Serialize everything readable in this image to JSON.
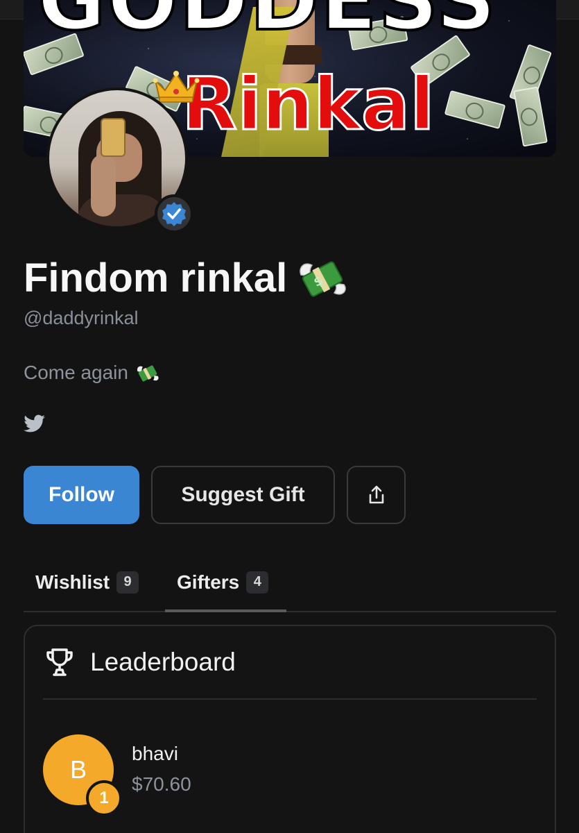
{
  "banner": {
    "title_text": "GODDESS",
    "name_text": "Rinkal"
  },
  "profile": {
    "display_name": "Findom rinkal",
    "handle": "@daddyrinkal",
    "bio": "Come again",
    "verified": true
  },
  "actions": {
    "follow_label": "Follow",
    "suggest_label": "Suggest Gift"
  },
  "tabs": [
    {
      "label": "Wishlist",
      "count": "9",
      "active": false
    },
    {
      "label": "Gifters",
      "count": "4",
      "active": true
    }
  ],
  "leaderboard": {
    "title": "Leaderboard",
    "entries": [
      {
        "initial": "B",
        "name": "bhavi",
        "amount": "$70.60",
        "rank": "1"
      }
    ]
  },
  "colors": {
    "accent": "#3a86d3",
    "rank_badge": "#f5a92a",
    "background": "#131313",
    "banner_name": "#e30d0d"
  },
  "icons": [
    "verified-check-icon",
    "money-with-wings-icon",
    "twitter-icon",
    "share-icon",
    "trophy-icon",
    "crown-icon"
  ]
}
